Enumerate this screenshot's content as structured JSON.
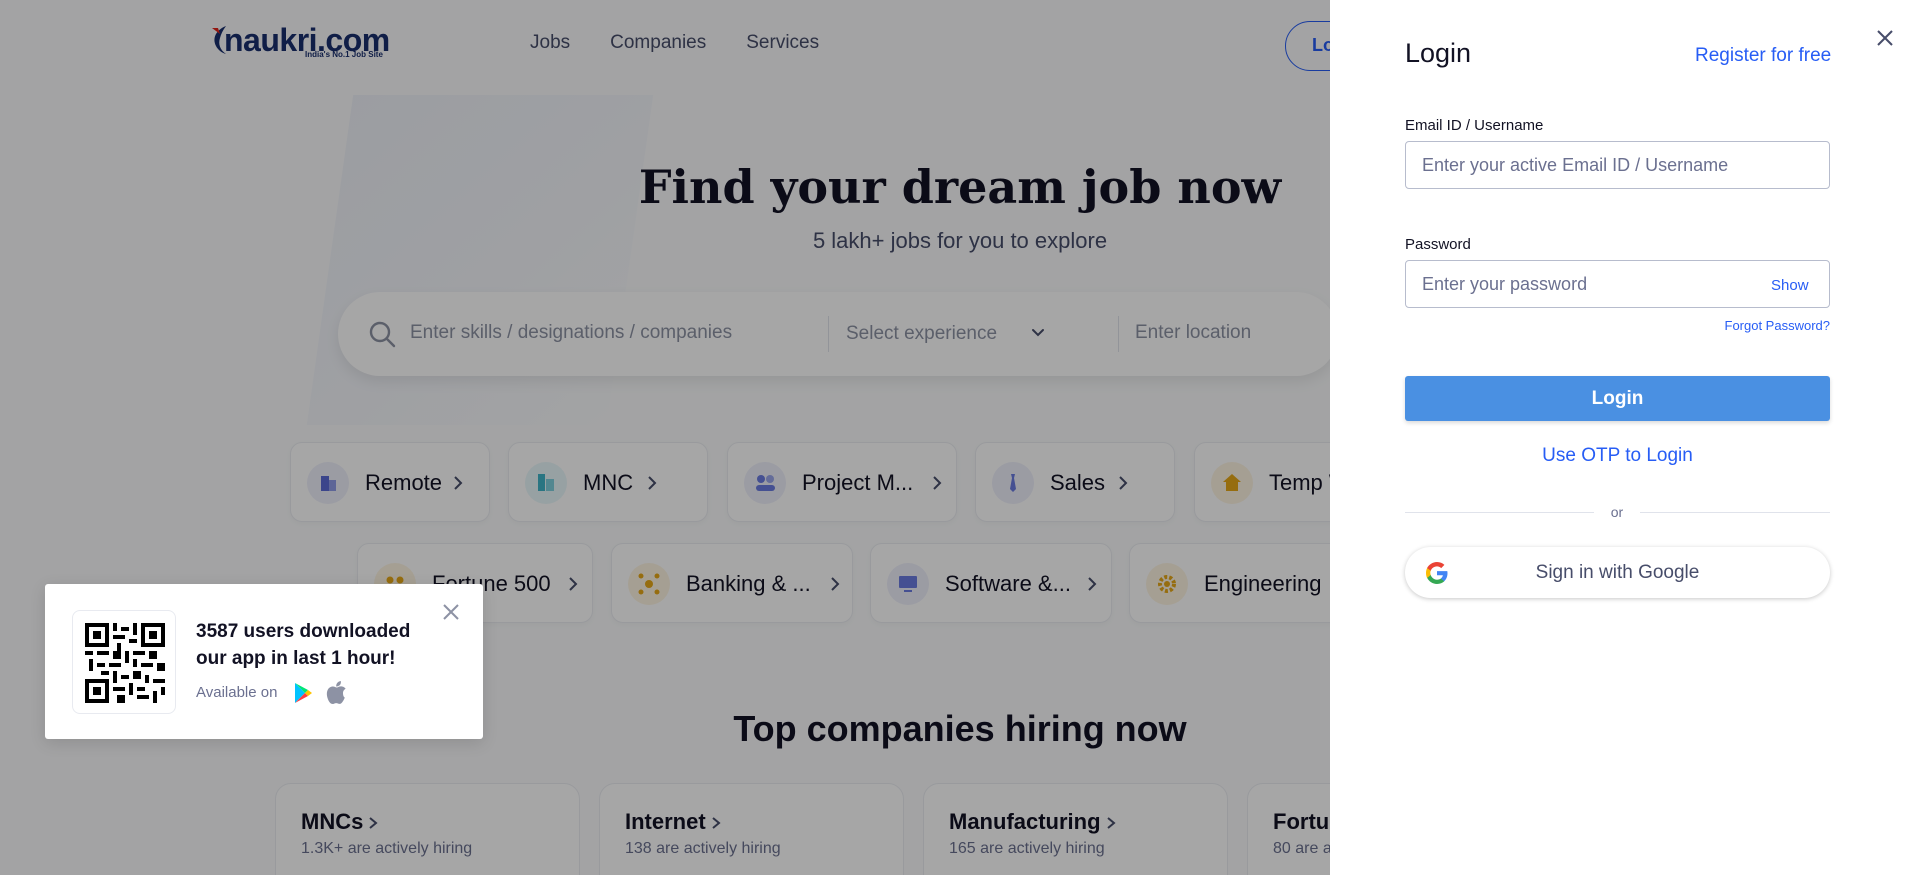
{
  "nav": {
    "logo_text": "naukri",
    "logo_domain": ".com",
    "logo_tagline": "India's No.1 Job Site",
    "links": [
      "Jobs",
      "Companies",
      "Services"
    ],
    "login_partial": "Lo"
  },
  "hero": {
    "title": "Find your dream job now",
    "subtitle": "5 lakh+ jobs for you to explore"
  },
  "search": {
    "skills_placeholder": "Enter skills / designations / companies",
    "experience_placeholder": "Select experience",
    "location_placeholder": "Enter location"
  },
  "categories_row1": [
    {
      "label": "Remote",
      "icon": "building-icon",
      "color": "#5b6bd6"
    },
    {
      "label": "MNC",
      "icon": "office-buildings-icon",
      "color": "#3fb4c8"
    },
    {
      "label": "Project M...",
      "icon": "people-icon",
      "color": "#6a7ce0"
    },
    {
      "label": "Sales",
      "icon": "tie-icon",
      "color": "#6a7ce0"
    },
    {
      "label": "Temp W",
      "icon": "house-icon",
      "color": "#e6a817"
    }
  ],
  "categories_row2": [
    {
      "label": "Fortune 500",
      "icon": "group-icon",
      "color": "#e6a817"
    },
    {
      "label": "Banking & ...",
      "icon": "network-icon",
      "color": "#e6a817"
    },
    {
      "label": "Software &...",
      "icon": "monitor-icon",
      "color": "#6a7ce0"
    },
    {
      "label": "Engineering",
      "icon": "gear-icon",
      "color": "#e6a817"
    }
  ],
  "top_companies": {
    "title": "Top companies hiring now",
    "cards": [
      {
        "name": "MNCs",
        "sub": "1.3K+ are actively hiring"
      },
      {
        "name": "Internet",
        "sub": "138 are actively hiring"
      },
      {
        "name": "Manufacturing",
        "sub": "165 are actively hiring"
      },
      {
        "name": "Fortun",
        "sub": "80 are a"
      }
    ]
  },
  "app_popup": {
    "message": "3587 users downloaded our app in last 1 hour!",
    "available_on": "Available on"
  },
  "login": {
    "title": "Login",
    "register_link": "Register for free",
    "email_label": "Email ID / Username",
    "email_placeholder": "Enter your active Email ID / Username",
    "password_label": "Password",
    "password_placeholder": "Enter your password",
    "show_label": "Show",
    "forgot_label": "Forgot Password?",
    "login_button": "Login",
    "otp_link": "Use OTP to Login",
    "or_label": "or",
    "google_button": "Sign in with Google"
  },
  "colors": {
    "brand_blue": "#275df5",
    "login_button": "#4a90e2",
    "navy": "#1a2f6e"
  }
}
